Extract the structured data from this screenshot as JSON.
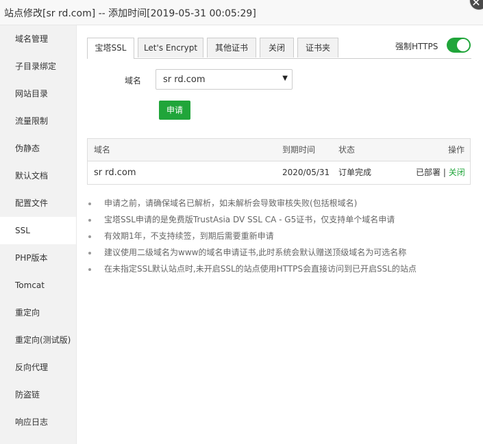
{
  "title": "站点修改[sr    rd.com] -- 添加时间[2019-05-31 00:05:29]",
  "close_symbol": "✕",
  "sidebar": {
    "items": [
      {
        "label": "域名管理"
      },
      {
        "label": "子目录绑定"
      },
      {
        "label": "网站目录"
      },
      {
        "label": "流量限制"
      },
      {
        "label": "伪静态"
      },
      {
        "label": "默认文档"
      },
      {
        "label": "配置文件"
      },
      {
        "label": "SSL"
      },
      {
        "label": "PHP版本"
      },
      {
        "label": "Tomcat"
      },
      {
        "label": "重定向"
      },
      {
        "label": "重定向(测试版)"
      },
      {
        "label": "反向代理"
      },
      {
        "label": "防盗链"
      },
      {
        "label": "响应日志"
      }
    ],
    "active_index": 7
  },
  "tabs": [
    {
      "label": "宝塔SSL"
    },
    {
      "label": "Let's Encrypt"
    },
    {
      "label": "其他证书"
    },
    {
      "label": "关闭"
    },
    {
      "label": "证书夹"
    }
  ],
  "https": {
    "label": "强制HTTPS",
    "enabled": true
  },
  "form": {
    "domain_label": "域名",
    "domain_value": "sr    rd.com",
    "dropdown_arrow": "▼",
    "apply_label": "申请"
  },
  "table": {
    "headers": {
      "domain": "域名",
      "expire": "到期时间",
      "status": "状态",
      "actions": "操作"
    },
    "rows": [
      {
        "domain": "sr    rd.com",
        "expire": "2020/05/31",
        "status": "订单完成",
        "action_deployed": "已部署",
        "action_sep": "|",
        "action_close": "关闭"
      }
    ]
  },
  "tips": [
    "申请之前，请确保域名已解析，如未解析会导致审核失败(包括根域名)",
    "宝塔SSL申请的是免费版TrustAsia DV SSL CA - G5证书，仅支持单个域名申请",
    "有效期1年，不支持续签，到期后需要重新申请",
    "建议使用二级域名为www的域名申请证书,此时系统会默认赠送顶级域名为可选名称",
    "在未指定SSL默认站点时,未开启SSL的站点使用HTTPS会直接访问到已开启SSL的站点"
  ],
  "colors": {
    "accent": "#20a53a",
    "sidebar_bg": "#f2f2f2"
  }
}
